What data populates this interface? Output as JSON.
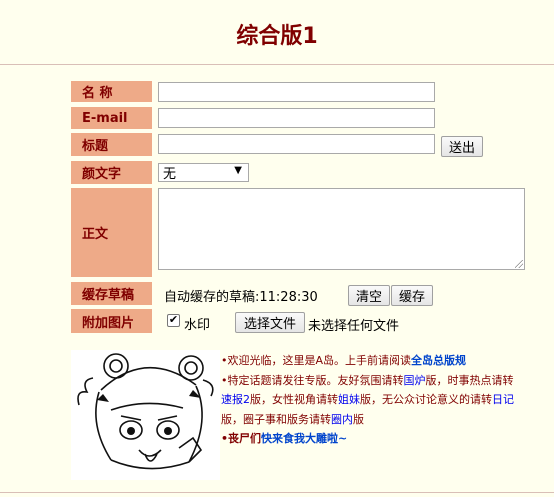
{
  "page": {
    "title": "综合版1"
  },
  "form": {
    "name_label": "名 称",
    "email_label": "E-mail",
    "subject_label": "标题",
    "submit_label": "送出",
    "emoji_label": "颜文字",
    "emoji_selected": "无",
    "body_label": "正文",
    "draft_label": "缓存草稿",
    "draft_status": "自动缓存的草稿:11:28:30",
    "clear_label": "清空",
    "save_label": "缓存",
    "image_label": "附加图片",
    "watermark_label": "水印",
    "watermark_checked": true,
    "choose_file_label": "选择文件",
    "no_file_label": "未选择任何文件"
  },
  "notice": {
    "line1_prefix": "•欢迎光临，这里是A岛。上手前请阅读",
    "line1_link": "全岛总版规",
    "line2_prefix": "•特定话题请发往专版。友好氛围请转",
    "line2_link1": "国炉",
    "line2_mid1": "版，时事热点请转",
    "line2_link2": "速报2",
    "line2_mid2": "版，女性视角请转",
    "line2_link3": "姐妹",
    "line2_mid3": "版，无公众讨论意义的请转",
    "line2_link4": "日记",
    "line2_mid4": "版，圈子事和版务请转",
    "line2_link5": "圈内",
    "line2_suffix": "版",
    "line3_prefix": "•丧尸们",
    "line3_link": "快来食我大雕啦~"
  }
}
